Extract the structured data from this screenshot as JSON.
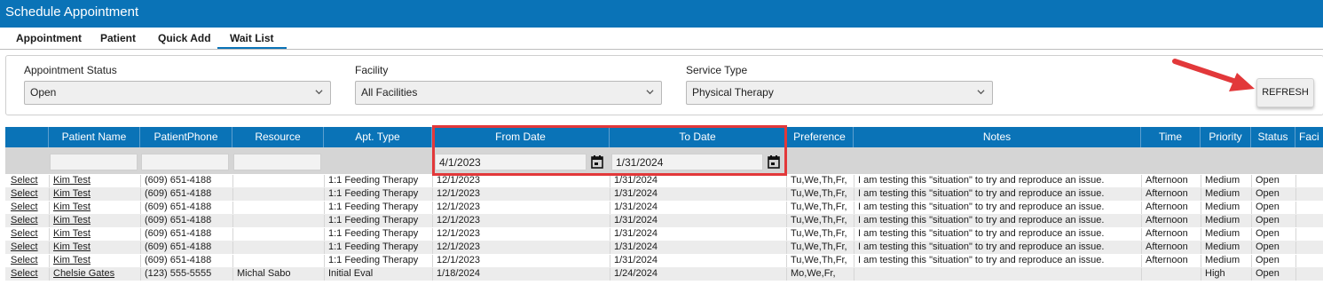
{
  "window": {
    "title": "Schedule Appointment"
  },
  "tabs": [
    {
      "label": "Appointment"
    },
    {
      "label": "Patient"
    },
    {
      "label": "Quick Add"
    },
    {
      "label": "Wait List",
      "active": true
    }
  ],
  "filters": {
    "appointment_status": {
      "label": "Appointment Status",
      "value": "Open"
    },
    "facility": {
      "label": "Facility",
      "value": "All Facilities"
    },
    "service_type": {
      "label": "Service Type",
      "value": "Physical Therapy"
    },
    "refresh_label": "REFRESH"
  },
  "grid": {
    "columns": [
      "Patient Name",
      "PatientPhone",
      "Resource",
      "Apt. Type",
      "From Date",
      "To Date",
      "Preference",
      "Notes",
      "Time",
      "Priority",
      "Status",
      "Faci"
    ],
    "filter_row": {
      "from_date": "4/1/2023",
      "to_date": "1/31/2024"
    },
    "select_label": "Select",
    "rows": [
      {
        "patient": "Kim Test",
        "phone": "(609) 651-4188",
        "resource": "",
        "apt_type": "1:1 Feeding Therapy",
        "from": "12/1/2023",
        "to": "1/31/2024",
        "preference": "Tu,We,Th,Fr,",
        "notes": "I am testing this \"situation\" to try and reproduce an issue.",
        "time": "Afternoon",
        "priority": "Medium",
        "status": "Open"
      },
      {
        "patient": "Kim Test",
        "phone": "(609) 651-4188",
        "resource": "",
        "apt_type": "1:1 Feeding Therapy",
        "from": "12/1/2023",
        "to": "1/31/2024",
        "preference": "Tu,We,Th,Fr,",
        "notes": "I am testing this \"situation\" to try and reproduce an issue.",
        "time": "Afternoon",
        "priority": "Medium",
        "status": "Open"
      },
      {
        "patient": "Kim Test",
        "phone": "(609) 651-4188",
        "resource": "",
        "apt_type": "1:1 Feeding Therapy",
        "from": "12/1/2023",
        "to": "1/31/2024",
        "preference": "Tu,We,Th,Fr,",
        "notes": "I am testing this \"situation\" to try and reproduce an issue.",
        "time": "Afternoon",
        "priority": "Medium",
        "status": "Open"
      },
      {
        "patient": "Kim Test",
        "phone": "(609) 651-4188",
        "resource": "",
        "apt_type": "1:1 Feeding Therapy",
        "from": "12/1/2023",
        "to": "1/31/2024",
        "preference": "Tu,We,Th,Fr,",
        "notes": "I am testing this \"situation\" to try and reproduce an issue.",
        "time": "Afternoon",
        "priority": "Medium",
        "status": "Open"
      },
      {
        "patient": "Kim Test",
        "phone": "(609) 651-4188",
        "resource": "",
        "apt_type": "1:1 Feeding Therapy",
        "from": "12/1/2023",
        "to": "1/31/2024",
        "preference": "Tu,We,Th,Fr,",
        "notes": "I am testing this \"situation\" to try and reproduce an issue.",
        "time": "Afternoon",
        "priority": "Medium",
        "status": "Open"
      },
      {
        "patient": "Kim Test",
        "phone": "(609) 651-4188",
        "resource": "",
        "apt_type": "1:1 Feeding Therapy",
        "from": "12/1/2023",
        "to": "1/31/2024",
        "preference": "Tu,We,Th,Fr,",
        "notes": "I am testing this \"situation\" to try and reproduce an issue.",
        "time": "Afternoon",
        "priority": "Medium",
        "status": "Open"
      },
      {
        "patient": "Kim Test",
        "phone": "(609) 651-4188",
        "resource": "",
        "apt_type": "1:1 Feeding Therapy",
        "from": "12/1/2023",
        "to": "1/31/2024",
        "preference": "Tu,We,Th,Fr,",
        "notes": "I am testing this \"situation\" to try and reproduce an issue.",
        "time": "Afternoon",
        "priority": "Medium",
        "status": "Open"
      },
      {
        "patient": "Chelsie Gates",
        "phone": "(123) 555-5555",
        "resource": "Michal Sabo",
        "apt_type": "Initial Eval",
        "from": "1/18/2024",
        "to": "1/24/2024",
        "preference": "Mo,We,Fr,",
        "notes": "",
        "time": "",
        "priority": "High",
        "status": "Open"
      }
    ]
  },
  "colors": {
    "header_blue": "#0a73b7",
    "annotation_red": "#e2383a"
  },
  "icons": [
    "chevron-down-icon",
    "calendar-icon",
    "red-arrow-annotation"
  ]
}
